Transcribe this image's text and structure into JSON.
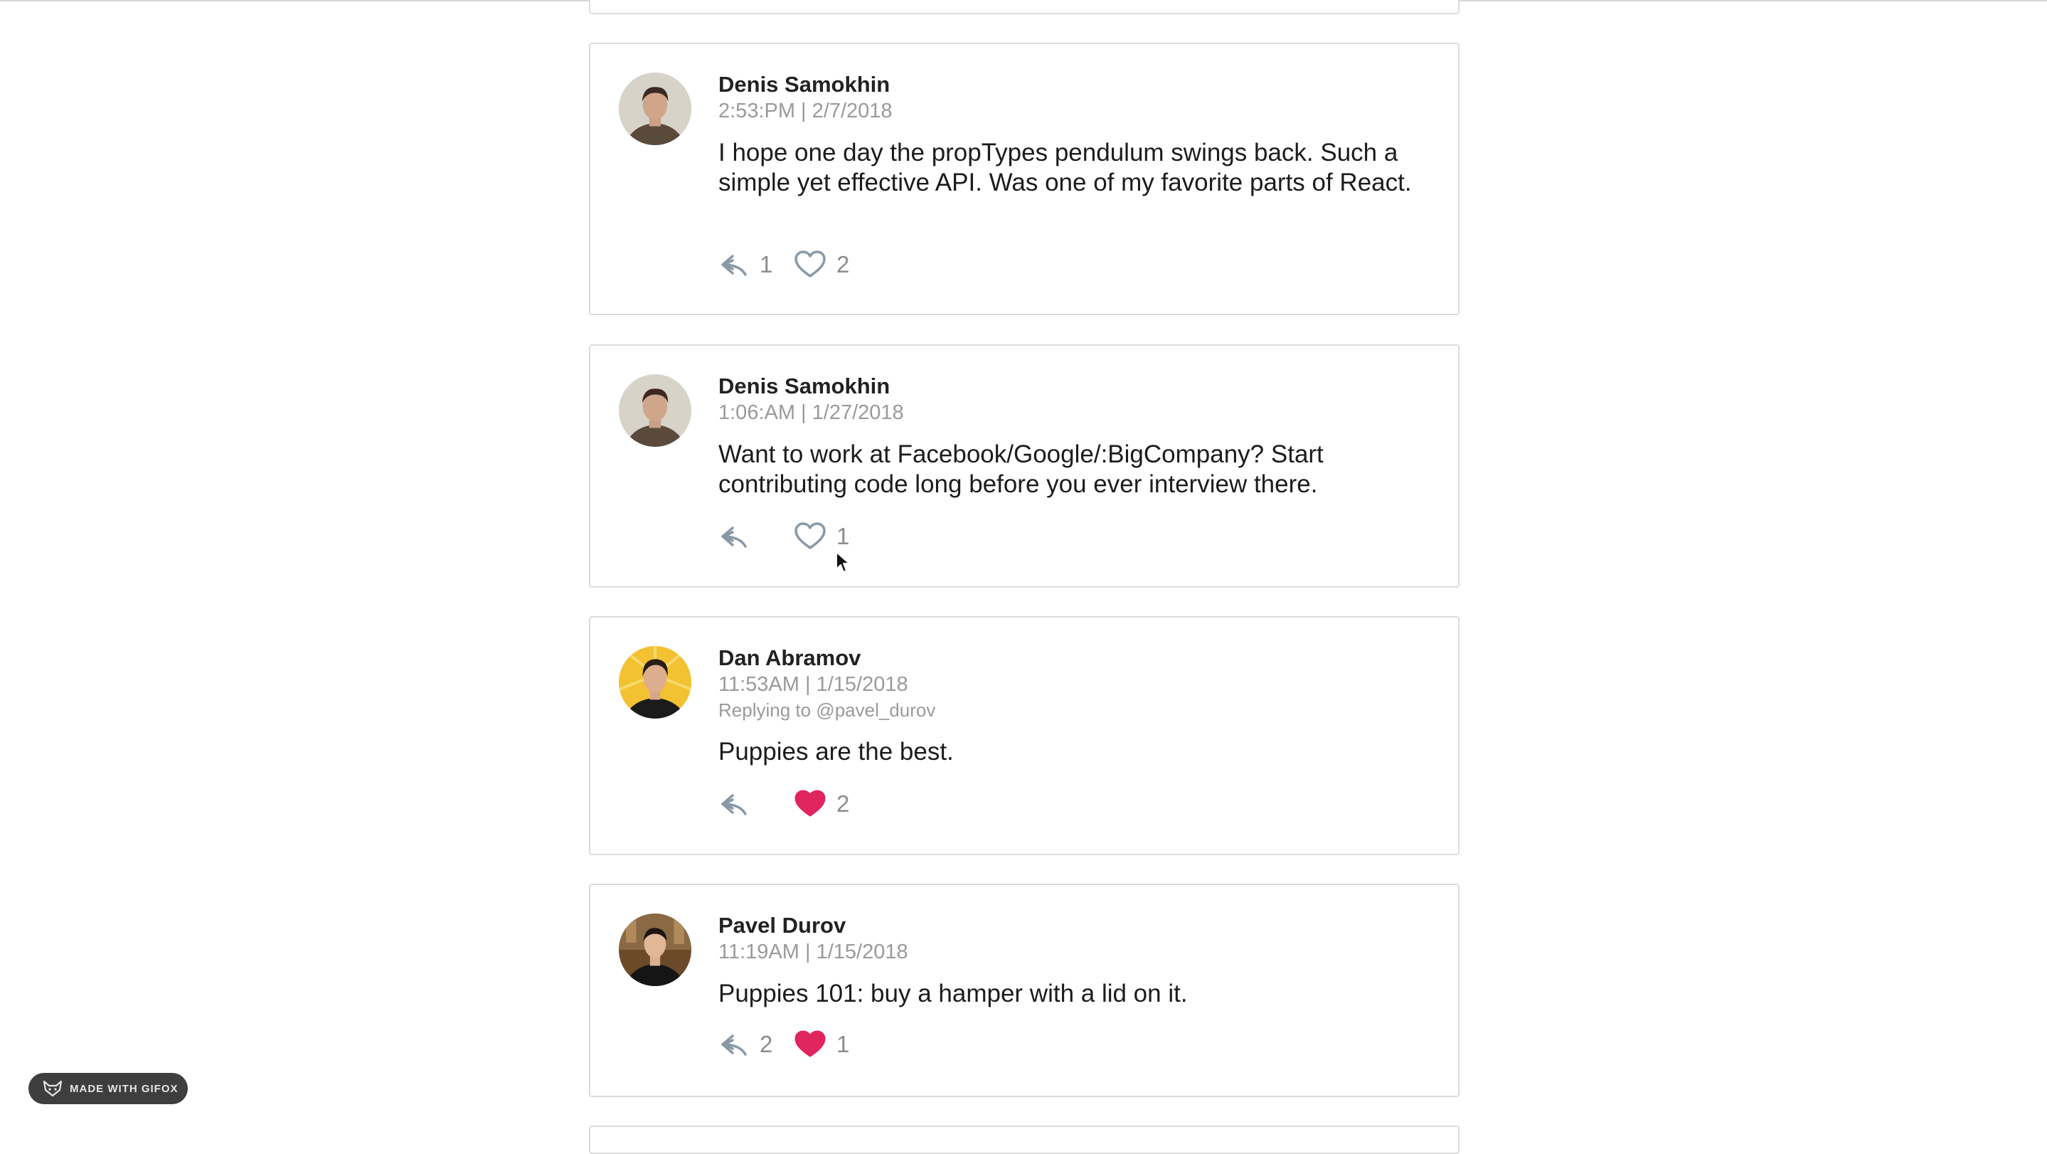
{
  "tweets": [
    {
      "author": "Denis Samokhin",
      "timestamp": "2:53:PM | 2/7/2018",
      "replying_to": "",
      "text": "I hope one day the propTypes pendulum swings back. Such a simple yet effective API. Was one of my favorite parts of React.",
      "reply_count": "1",
      "like_count": "2",
      "liked": false,
      "avatar": "avatar-denis"
    },
    {
      "author": "Denis Samokhin",
      "timestamp": "1:06:AM | 1/27/2018",
      "replying_to": "",
      "text": "Want to work at Facebook/Google/:BigCompany? Start contributing code long before you ever interview there.",
      "reply_count": "",
      "like_count": "1",
      "liked": false,
      "avatar": "avatar-denis"
    },
    {
      "author": "Dan Abramov",
      "timestamp": "11:53AM | 1/15/2018",
      "replying_to": "Replying to @pavel_durov",
      "text": "Puppies are the best.",
      "reply_count": "",
      "like_count": "2",
      "liked": true,
      "avatar": "avatar-dan"
    },
    {
      "author": "Pavel Durov",
      "timestamp": "11:19AM | 1/15/2018",
      "replying_to": "",
      "text": "Puppies 101: buy a hamper with a lid on it.",
      "reply_count": "2",
      "like_count": "1",
      "liked": true,
      "avatar": "avatar-pavel"
    }
  ],
  "colors": {
    "liked_heart": "#e0245e",
    "icon_gray": "#8899a6",
    "border": "#dcdcdc"
  },
  "icons": {
    "reply": "reply-arrow-icon",
    "like": "heart-icon"
  },
  "watermark": {
    "label": "MADE WITH GIFOX"
  }
}
